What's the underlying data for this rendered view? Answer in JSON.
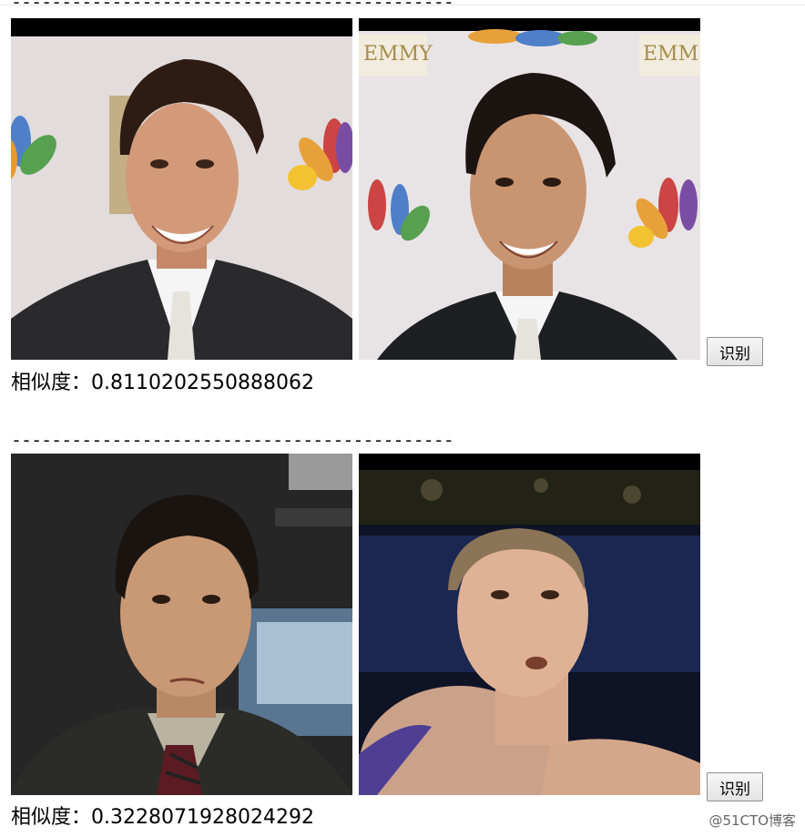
{
  "separator": "--------------------------------------------",
  "pairs": [
    {
      "left_image_alt": "face photo",
      "right_image_alt": "face photo",
      "button_label": "识别",
      "similarity_label": "相似度：",
      "similarity_value": "0.8110202550888062",
      "left_banner_text": "",
      "right_banner_text": "EMMY"
    },
    {
      "left_image_alt": "face photo",
      "right_image_alt": "face photo",
      "button_label": "识别",
      "similarity_label": "相似度：",
      "similarity_value": "0.3228071928024292"
    }
  ],
  "watermark": "@51CTO博客"
}
